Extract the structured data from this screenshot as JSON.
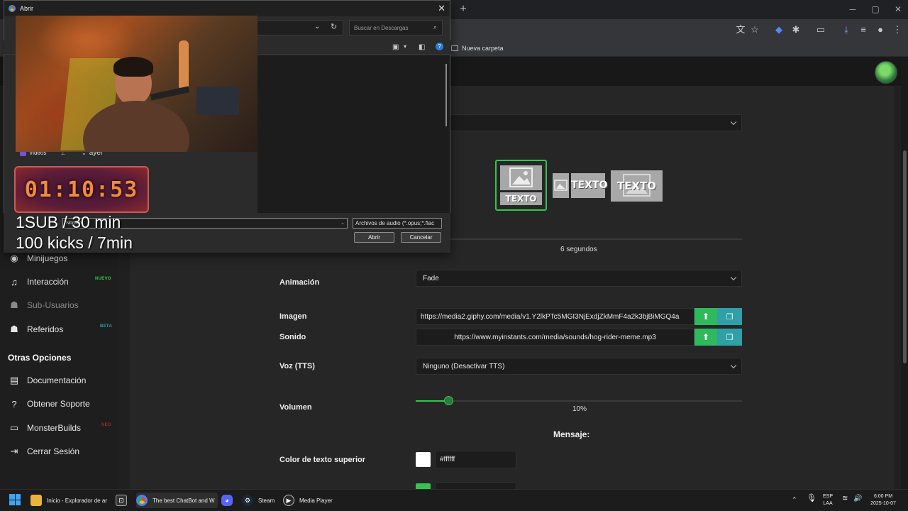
{
  "dialog": {
    "title": "Abrir",
    "search_placeholder": "Buscar en Descargas",
    "nav_videos": "Videos",
    "group_yesterday": "ayer",
    "filename_label": "Nombre:",
    "filter_value": "Archivos de audio (*.opus;*.flac",
    "open_label": "Abrir",
    "cancel_label": "Cancelar"
  },
  "browser": {
    "bookmark_folder": "Nueva carpeta"
  },
  "overlay": {
    "timer": "01:10:53",
    "line1": "1SUB / 30 min",
    "line2": "100 kicks / 7min"
  },
  "sidebar": {
    "items": [
      {
        "label": "Minijuegos",
        "icon": "gamepad-icon"
      },
      {
        "label": "Interacción",
        "icon": "music-note-icon",
        "badge": "NUEVO"
      },
      {
        "label": "Sub-Usuarios",
        "icon": "users-icon"
      },
      {
        "label": "Referidos",
        "icon": "referrals-icon",
        "badge": "BETA"
      }
    ],
    "other_heading": "Otras Opciones",
    "other_items": [
      {
        "label": "Documentación",
        "icon": "book-icon"
      },
      {
        "label": "Obtener Soporte",
        "icon": "help-icon"
      },
      {
        "label": "MonsterBuilds",
        "icon": "laptop-icon",
        "badge": "NEO"
      },
      {
        "label": "Cerrar Sesión",
        "icon": "logout-icon"
      }
    ]
  },
  "form": {
    "layout_text": "TEXTO",
    "duration_value": "6 segundos",
    "animation_label": "Animación",
    "animation_value": "Fade",
    "image_label": "Imagen",
    "image_value": "https://media2.giphy.com/media/v1.Y2lkPTc5MGI3NjExdjZkMmF4a2k3bjBiMGQ4a",
    "sound_label": "Sonido",
    "sound_value": "https://www.myinstants.com/media/sounds/hog-rider-meme.mp3",
    "voice_label": "Voz (TTS)",
    "voice_value": "Ninguno (Desactivar TTS)",
    "volume_label": "Volumen",
    "volume_value": "10%",
    "volume_fraction": 0.1,
    "message_heading": "Mensaje:",
    "top_text_color_label": "Color de texto superior",
    "top_text_color_value": "#ffffff",
    "accent_color": "#35c44e"
  },
  "taskbar": {
    "apps": [
      {
        "label": "Inicio - Explorador de ar",
        "icon": "folder-icon"
      },
      {
        "label": "",
        "icon": "app-icon"
      },
      {
        "label": "The best ChatBot and W",
        "icon": "chrome-icon"
      },
      {
        "label": "",
        "icon": "discord-icon"
      },
      {
        "label": "Steam",
        "icon": "steam-icon"
      },
      {
        "label": "Media Player",
        "icon": "media-player-icon"
      }
    ],
    "lang_top": "ESP",
    "lang_bottom": "LAA",
    "time": "6:00 PM",
    "date": "2025-10-07"
  }
}
